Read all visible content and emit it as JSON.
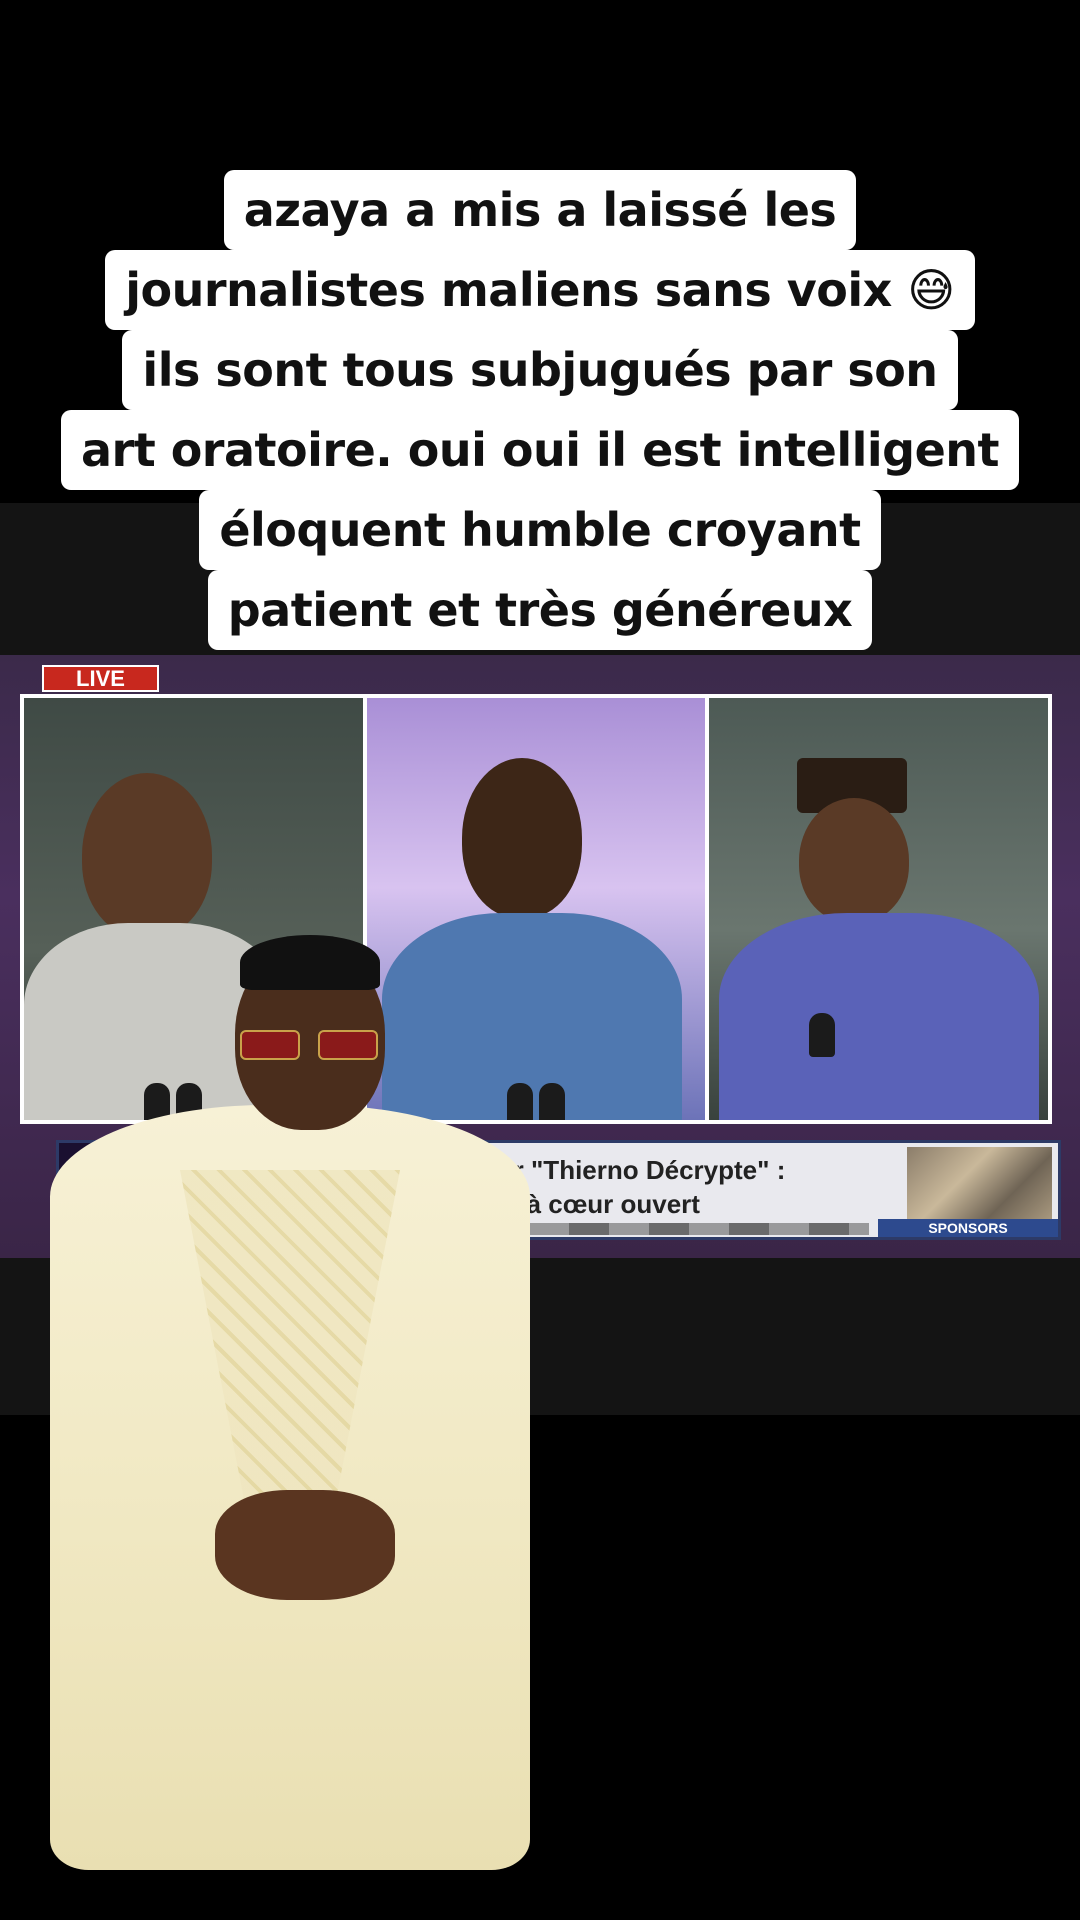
{
  "caption": {
    "lines": [
      "azaya a mis a laissé les",
      "journalistes maliens sans voix 😅",
      "ils sont tous subjugués par son",
      "art oratoire. oui oui il est intelligent",
      "éloquent humble croyant",
      "patient et très généreux"
    ]
  },
  "broadcast": {
    "live_label": "LIVE",
    "ticker": {
      "line1": "le silence sur \"Thierno Décrypte\" :",
      "line2": "ns attendues à cœur ouvert"
    },
    "sponsor_label": "SPONSORS"
  },
  "colors": {
    "live_red": "#c8281e",
    "tv_purple": "#4a2f5e",
    "ticker_blue": "#2d3a67"
  }
}
